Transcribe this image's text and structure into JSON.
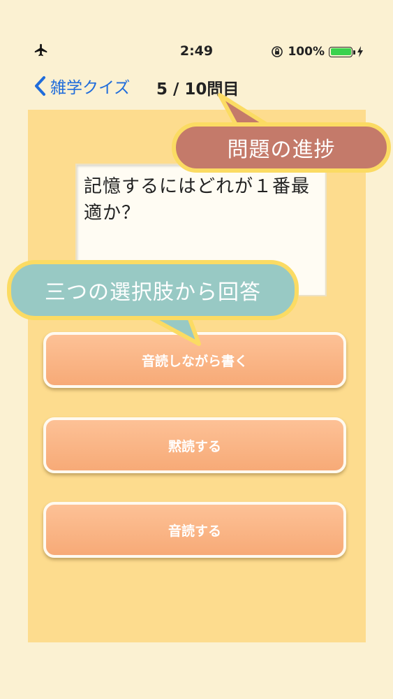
{
  "status_bar": {
    "time": "2:49",
    "battery_text": "100%",
    "icons": [
      "airplane-icon",
      "orientation-lock-icon",
      "battery-icon",
      "charging-icon"
    ]
  },
  "nav": {
    "back_label": "雑学クイズ",
    "progress_title": "5 / 10問目"
  },
  "question": {
    "text": "記憶するにはどれが１番最適か？"
  },
  "answers": [
    {
      "label": "音読しながら書く"
    },
    {
      "label": "黙読する"
    },
    {
      "label": "音読する"
    }
  ],
  "callouts": {
    "progress": "問題の進捗",
    "answers": "三つの選択肢から回答"
  },
  "colors": {
    "background": "#fbf1d2",
    "panel": "#fddc8e",
    "button": "#f7aa77",
    "callout_progress": "#c47a6a",
    "callout_answers": "#98c9c4",
    "callout_border": "#fbdb63",
    "link": "#1f6cdb"
  }
}
